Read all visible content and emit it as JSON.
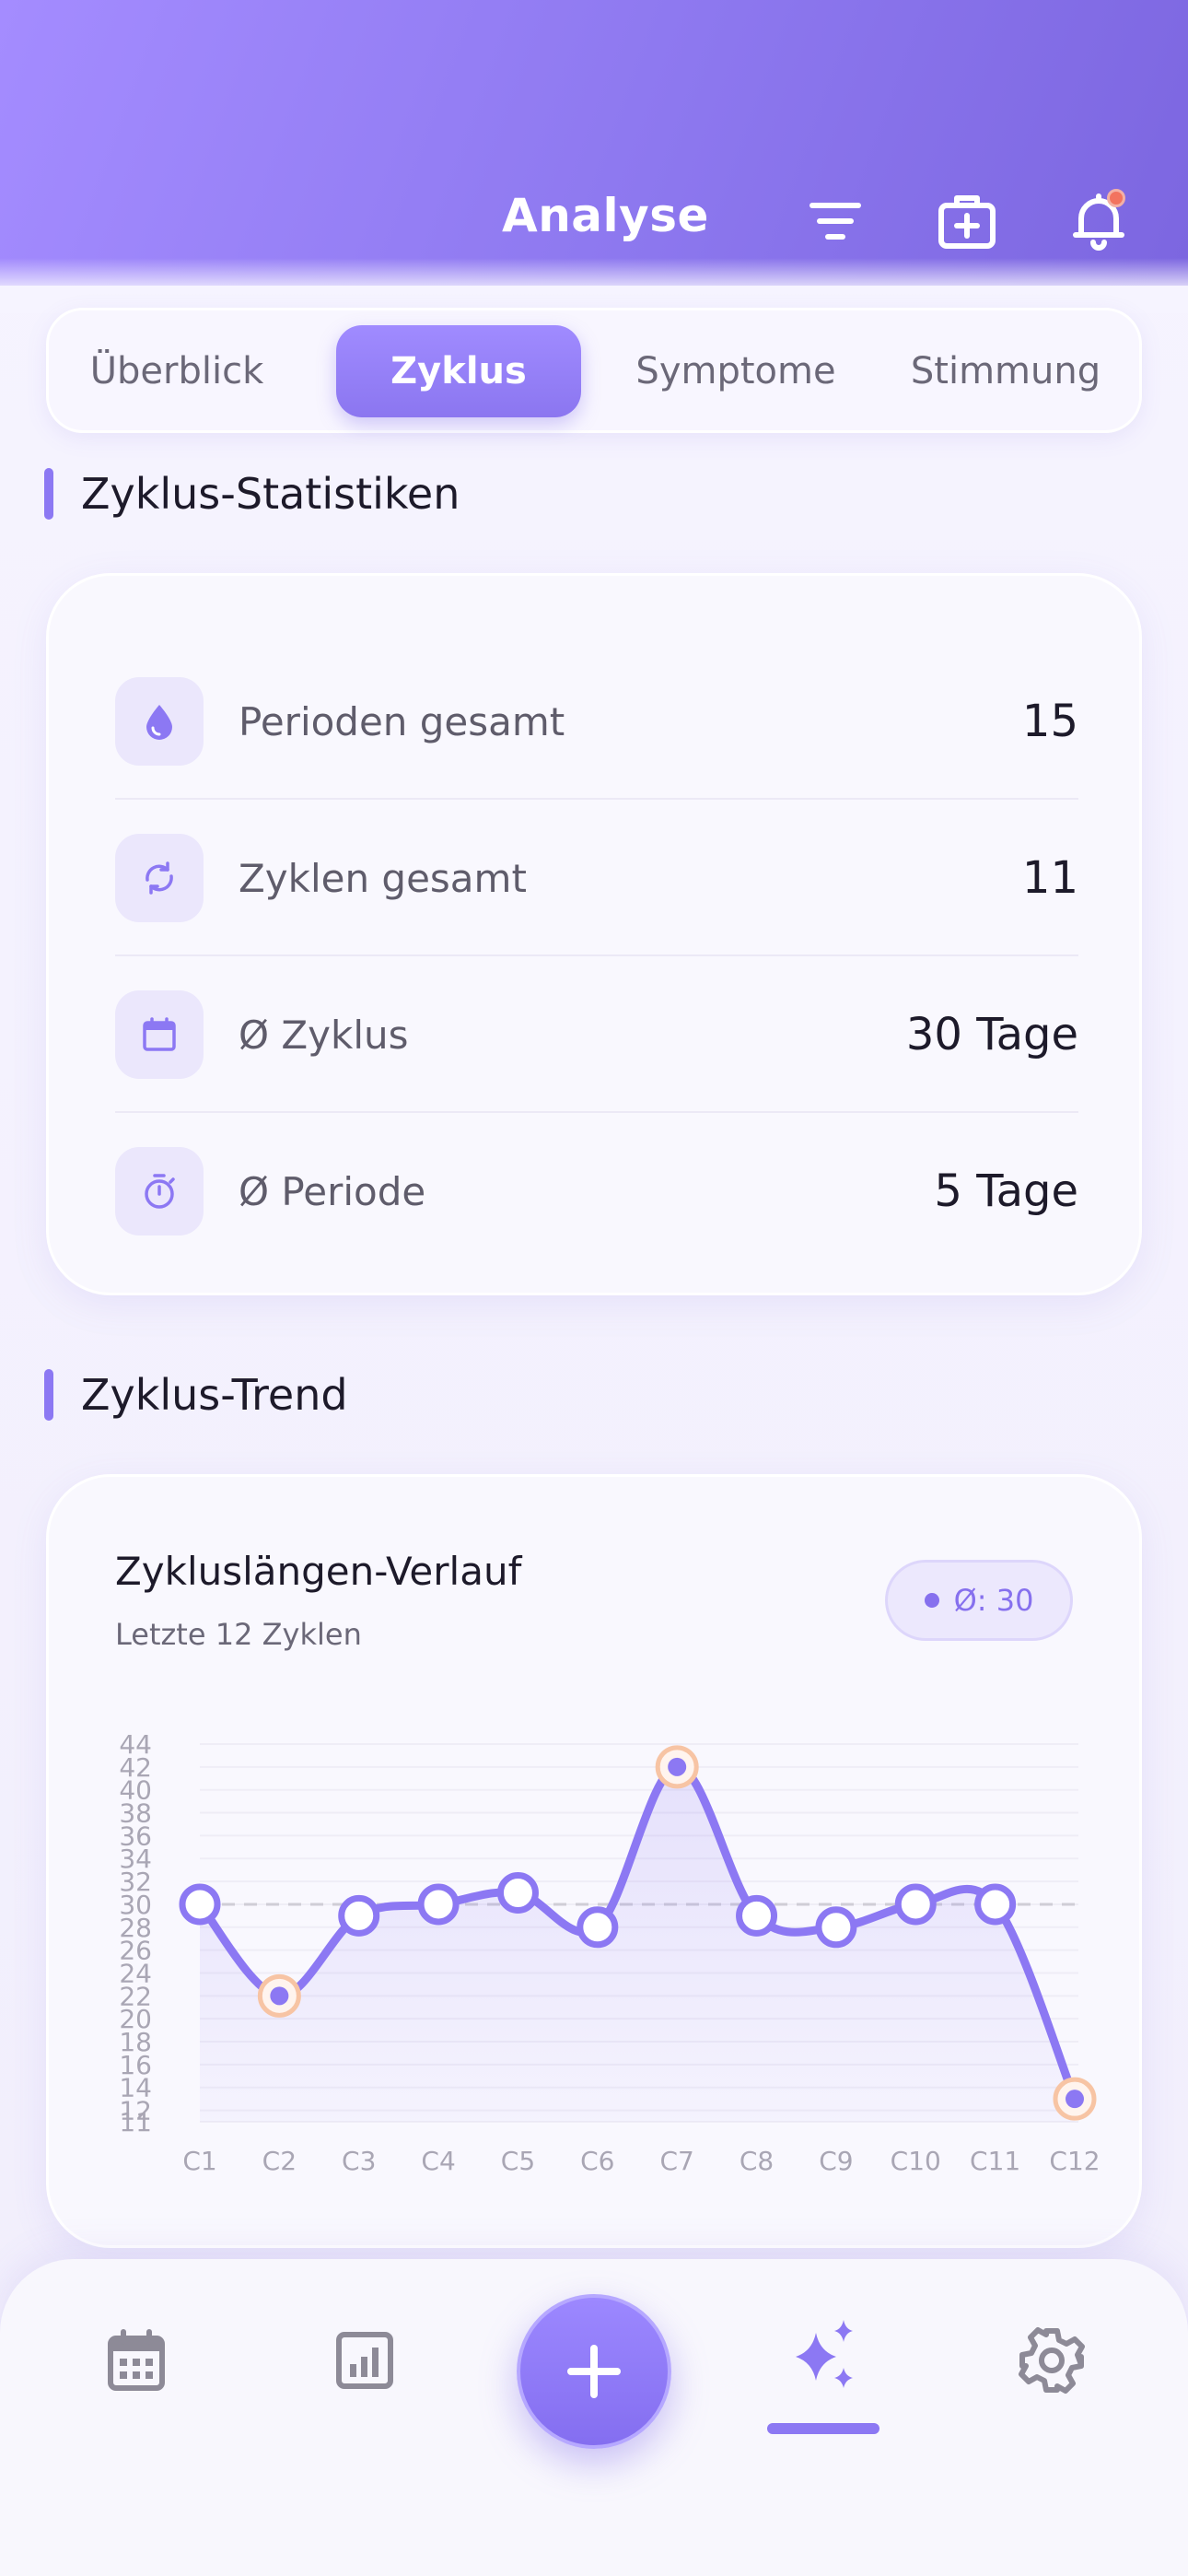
{
  "header": {
    "title": "Analyse"
  },
  "tabs": [
    {
      "label": "Überblick",
      "active": false
    },
    {
      "label": "Zyklus",
      "active": true
    },
    {
      "label": "Symptome",
      "active": false
    },
    {
      "label": "Stimmung",
      "active": false
    }
  ],
  "stats_section": {
    "title": "Zyklus-Statistiken",
    "rows": [
      {
        "icon": "drop-icon",
        "label": "Perioden gesamt",
        "value": "15"
      },
      {
        "icon": "cycle-icon",
        "label": "Zyklen gesamt",
        "value": "11"
      },
      {
        "icon": "calendar-icon",
        "label": "Ø Zyklus",
        "value": "30 Tage"
      },
      {
        "icon": "timer-icon",
        "label": "Ø Periode",
        "value": "5 Tage"
      }
    ]
  },
  "trend_section": {
    "title": "Zyklus-Trend",
    "card_title": "Zykluslängen-Verlauf",
    "card_subtitle": "Letzte 12 Zyklen",
    "average_pill": "Ø: 30"
  },
  "chart_data": {
    "type": "line",
    "categories": [
      "C1",
      "C2",
      "C3",
      "C4",
      "C5",
      "C6",
      "C7",
      "C8",
      "C9",
      "C10",
      "C11",
      "C12"
    ],
    "values": [
      30,
      22,
      29,
      30,
      31,
      28,
      42,
      29,
      28,
      30,
      30,
      13
    ],
    "highlighted": [
      false,
      true,
      false,
      false,
      false,
      false,
      true,
      false,
      false,
      false,
      false,
      true
    ],
    "average": 30,
    "ylim": [
      11,
      44
    ],
    "yticks": [
      11,
      12,
      14,
      16,
      18,
      20,
      22,
      24,
      26,
      28,
      30,
      32,
      34,
      36,
      38,
      40,
      42,
      44
    ],
    "grid": true,
    "colors": {
      "line": "#8c78f3",
      "highlight": "#f7c4a4",
      "average_line": "#cfcdd6"
    }
  },
  "bottom_nav": {
    "items": [
      {
        "icon": "calendar-grid-icon",
        "active": false
      },
      {
        "icon": "bar-chart-icon",
        "active": false
      },
      {
        "icon": "plus-icon",
        "active": false
      },
      {
        "icon": "sparkles-icon",
        "active": true
      },
      {
        "icon": "gear-icon",
        "active": false
      }
    ]
  },
  "colors": {
    "accent": "#8c78f3",
    "header_start": "#a48cff",
    "header_end": "#7c66e0",
    "notification": "#f2735f"
  }
}
